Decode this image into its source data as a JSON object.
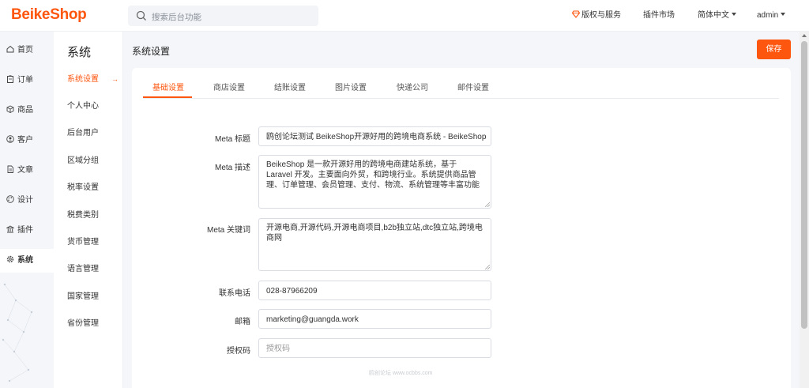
{
  "app": {
    "logo_text": "BeikeShop",
    "brand_color": "#fd560f"
  },
  "header": {
    "search_placeholder": "搜索后台功能",
    "copyright_label": "版权与服务",
    "plugin_market_label": "插件市场",
    "language_label": "简体中文",
    "user_label": "admin"
  },
  "sidebar": {
    "items": [
      {
        "label": "首页",
        "icon": "home-icon"
      },
      {
        "label": "订单",
        "icon": "clipboard-icon"
      },
      {
        "label": "商品",
        "icon": "box-icon"
      },
      {
        "label": "客户",
        "icon": "user-circle-icon"
      },
      {
        "label": "文章",
        "icon": "document-icon"
      },
      {
        "label": "设计",
        "icon": "palette-icon"
      },
      {
        "label": "插件",
        "icon": "bank-icon"
      },
      {
        "label": "系统",
        "icon": "gear-icon",
        "active": true
      }
    ]
  },
  "submenu": {
    "title": "系统",
    "items": [
      {
        "label": "系统设置",
        "active": true
      },
      {
        "label": "个人中心"
      },
      {
        "label": "后台用户"
      },
      {
        "label": "区域分组"
      },
      {
        "label": "税率设置"
      },
      {
        "label": "税费类别"
      },
      {
        "label": "货币管理"
      },
      {
        "label": "语言管理"
      },
      {
        "label": "国家管理"
      },
      {
        "label": "省份管理"
      }
    ]
  },
  "main": {
    "page_title": "系统设置",
    "save_label": "保存",
    "tabs": [
      {
        "label": "基础设置",
        "active": true
      },
      {
        "label": "商店设置"
      },
      {
        "label": "结账设置"
      },
      {
        "label": "图片设置"
      },
      {
        "label": "快递公司"
      },
      {
        "label": "邮件设置"
      }
    ],
    "form": {
      "meta_title": {
        "label": "Meta 标题",
        "value": "鸥创论坛测试 BeikeShop开源好用的跨境电商系统 - BeikeShop"
      },
      "meta_description": {
        "label": "Meta 描述",
        "value": "BeikeShop 是一款开源好用的跨境电商建站系统，基于 Laravel 开发。主要面向外贸，和跨境行业。系统提供商品管理、订单管理、会员管理、支付、物流、系统管理等丰富功能"
      },
      "meta_keywords": {
        "label": "Meta 关键词",
        "value": "开源电商,开源代码,开源电商项目,b2b独立站,dtc独立站,跨境电商网"
      },
      "phone": {
        "label": "联系电话",
        "value": "028-87966209"
      },
      "email": {
        "label": "邮箱",
        "value": "marketing@guangda.work"
      },
      "license": {
        "label": "授权码",
        "placeholder": "授权码"
      }
    },
    "watermark": "鸥创论坛 www.ocbbs.com"
  }
}
